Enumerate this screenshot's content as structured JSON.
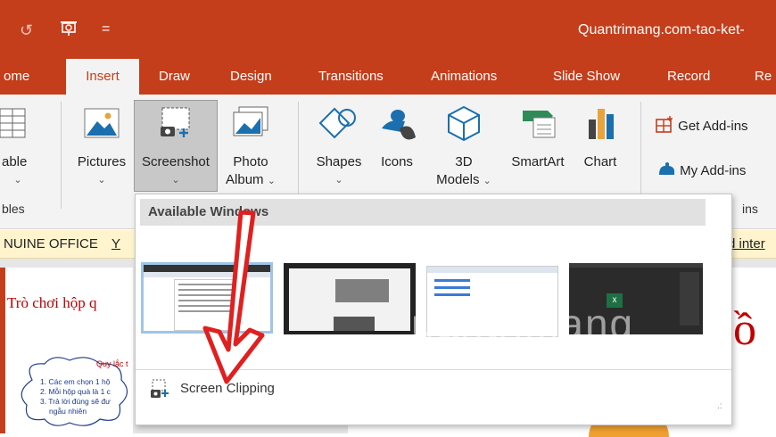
{
  "title_bar": {
    "document_title": "Quantrimang.com-tao-ket-",
    "undo_glyph": "↺",
    "customize_glyph": "="
  },
  "tabs": [
    "ome",
    "Insert",
    "Draw",
    "Design",
    "Transitions",
    "Animations",
    "Slide Show",
    "Record",
    "Re"
  ],
  "ribbon": {
    "table_label": "able",
    "table_group": "bles",
    "pictures": "Pictures",
    "screenshot": "Screenshot",
    "photo_album_1": "Photo",
    "photo_album_2": "Album",
    "shapes": "Shapes",
    "icons": "Icons",
    "models_1": "3D",
    "models_2": "Models",
    "smartart": "SmartArt",
    "chart": "Chart",
    "get_addins": "Get Add-ins",
    "my_addins": "My Add-ins",
    "addins_group": "ins"
  },
  "warning": {
    "left": "NUINE OFFICE",
    "y": "Y",
    "right": "d inter"
  },
  "slide_thumb": {
    "title": "Trò chơi hộp q"
  },
  "cloud_text": {
    "heading": "Quy lắc t",
    "line1": "1. Các em chọn 1 hộ",
    "line2": "2. Mỗi hộp quà là 1 c",
    "line3": "3. Trả lời đúng sẽ đư",
    "line4": "ngẫu nhiên"
  },
  "slide_big_char": "ồ",
  "popup": {
    "available_windows": "Available Windows",
    "screen_clipping": "Screen Clipping",
    "resize_glyph": ".:"
  },
  "watermark": "uantrimang",
  "colors": {
    "accent": "#c43e1c",
    "arrow": "#e02020"
  }
}
